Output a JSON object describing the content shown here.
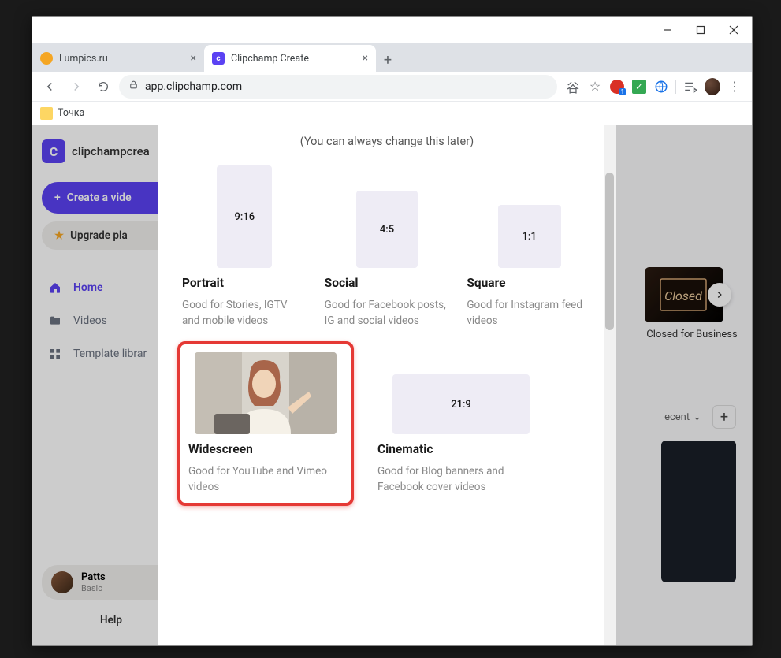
{
  "window": {
    "minimize": "−",
    "maximize": "□",
    "close": "✕"
  },
  "tabs": [
    {
      "label": "Lumpics.ru",
      "active": false
    },
    {
      "label": "Clipchamp Create",
      "active": true
    }
  ],
  "address": {
    "url": "app.clipchamp.com"
  },
  "bookmarks": [
    {
      "label": "Точка"
    }
  ],
  "sidebar": {
    "brand_initial": "C",
    "brand_name": "clipchampcrea",
    "create_label": "Create a vide",
    "upgrade_label": "Upgrade pla",
    "nav": [
      {
        "icon": "home",
        "label": "Home",
        "active": true
      },
      {
        "icon": "folder",
        "label": "Videos",
        "active": false
      },
      {
        "icon": "grid",
        "label": "Template librar",
        "active": false
      }
    ],
    "user": {
      "name": "Patts",
      "plan": "Basic"
    },
    "help_label": "Help"
  },
  "main": {
    "template": {
      "label": "Closed for Business"
    },
    "sort_label": "ecent",
    "plus": "+"
  },
  "modal": {
    "subtitle": "(You can always change this later)",
    "options": [
      {
        "ratio": "9:16",
        "title": "Portrait",
        "desc": "Good for Stories, IGTV and mobile videos",
        "shape": "portrait"
      },
      {
        "ratio": "4:5",
        "title": "Social",
        "desc": "Good for Facebook posts, IG and social videos",
        "shape": "social"
      },
      {
        "ratio": "1:1",
        "title": "Square",
        "desc": "Good for Instagram feed videos",
        "shape": "square"
      },
      {
        "ratio": "",
        "title": "Widescreen",
        "desc": "Good for YouTube and Vimeo videos",
        "shape": "wide"
      },
      {
        "ratio": "21:9",
        "title": "Cinematic",
        "desc": "Good for Blog banners and Facebook cover videos",
        "shape": "cine"
      }
    ]
  }
}
